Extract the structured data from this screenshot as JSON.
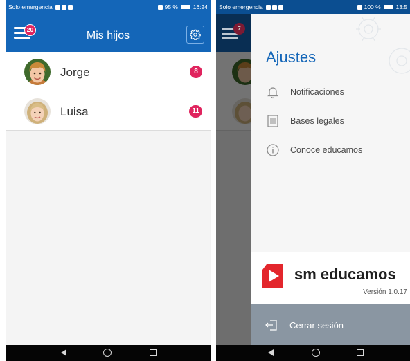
{
  "left_screen": {
    "status_bar": {
      "left_text": "Solo emergencia",
      "right_text": "95 %",
      "time": "16:24"
    },
    "app_bar": {
      "title": "Mis hijos",
      "menu_badge": "20",
      "settings_icon": "gear-icon",
      "menu_icon": "hamburger-menu-icon"
    },
    "children": [
      {
        "name": "Jorge",
        "count": "8"
      },
      {
        "name": "Luisa",
        "count": "11"
      }
    ]
  },
  "right_screen": {
    "status_bar": {
      "left_text": "Solo emergencia",
      "right_text": "100 %",
      "time": "13:5"
    },
    "menu_badge": "7",
    "drawer": {
      "title": "Ajustes",
      "items": [
        {
          "label": "Notificaciones",
          "icon": "bell-icon"
        },
        {
          "label": "Bases legales",
          "icon": "document-icon"
        },
        {
          "label": "Conoce educamos",
          "icon": "info-icon"
        }
      ],
      "brand_name": "sm educamos",
      "version": "Versión 1.0.17",
      "logout_label": "Cerrar sesión",
      "logout_icon": "logout-icon"
    }
  },
  "colors": {
    "primary_blue": "#1466b8",
    "badge_red": "#e0245e",
    "brand_red": "#e3262c",
    "logout_gray": "#8a96a2"
  }
}
